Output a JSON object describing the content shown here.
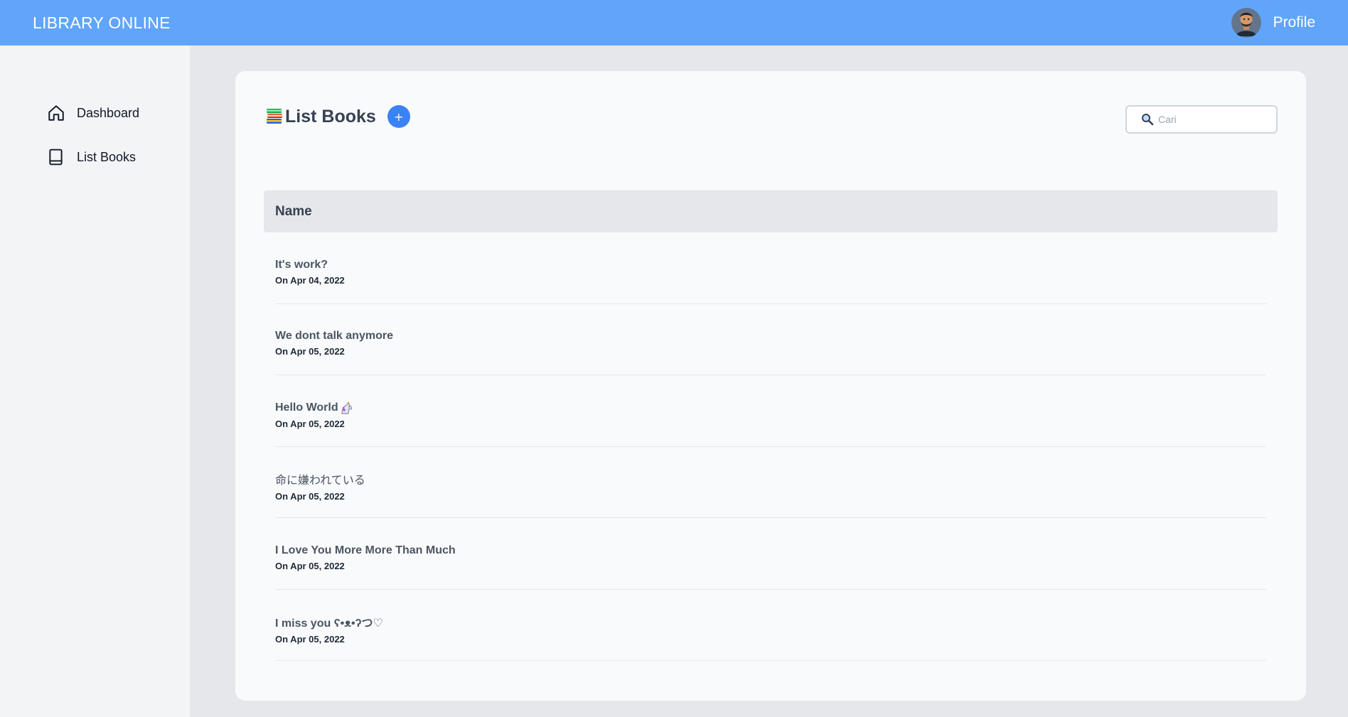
{
  "header": {
    "brand": "LIBRARY ONLINE",
    "profile_label": "Profile"
  },
  "sidebar": {
    "items": [
      {
        "label": "Dashboard",
        "icon": "home-icon"
      },
      {
        "label": "List Books",
        "icon": "book-icon"
      }
    ]
  },
  "main": {
    "title": "List Books",
    "title_icon": "books-icon",
    "add_button_label": "+",
    "search": {
      "placeholder": "Cari",
      "value": "",
      "icon": "search-icon"
    },
    "table": {
      "column_header": "Name",
      "rows": [
        {
          "title": "It's work?",
          "date": "On Apr 04, 2022"
        },
        {
          "title": "We dont talk anymore",
          "date": "On Apr 05, 2022"
        },
        {
          "title": "Hello World",
          "title_icon": "unicorn-icon",
          "date": "On Apr 05, 2022"
        },
        {
          "title": "命に嫌われている",
          "date": "On Apr 05, 2022"
        },
        {
          "title": "I Love You More More Than Much",
          "date": "On Apr 05, 2022"
        },
        {
          "title": "I miss you ʕ•ᴥ•ʔつ♡",
          "date": "On Apr 05, 2022"
        }
      ]
    }
  },
  "colors": {
    "header_bg": "#60a5fa",
    "accent": "#3b82f6",
    "page_bg": "#e5e7eb",
    "card_bg": "#f9fafb"
  }
}
